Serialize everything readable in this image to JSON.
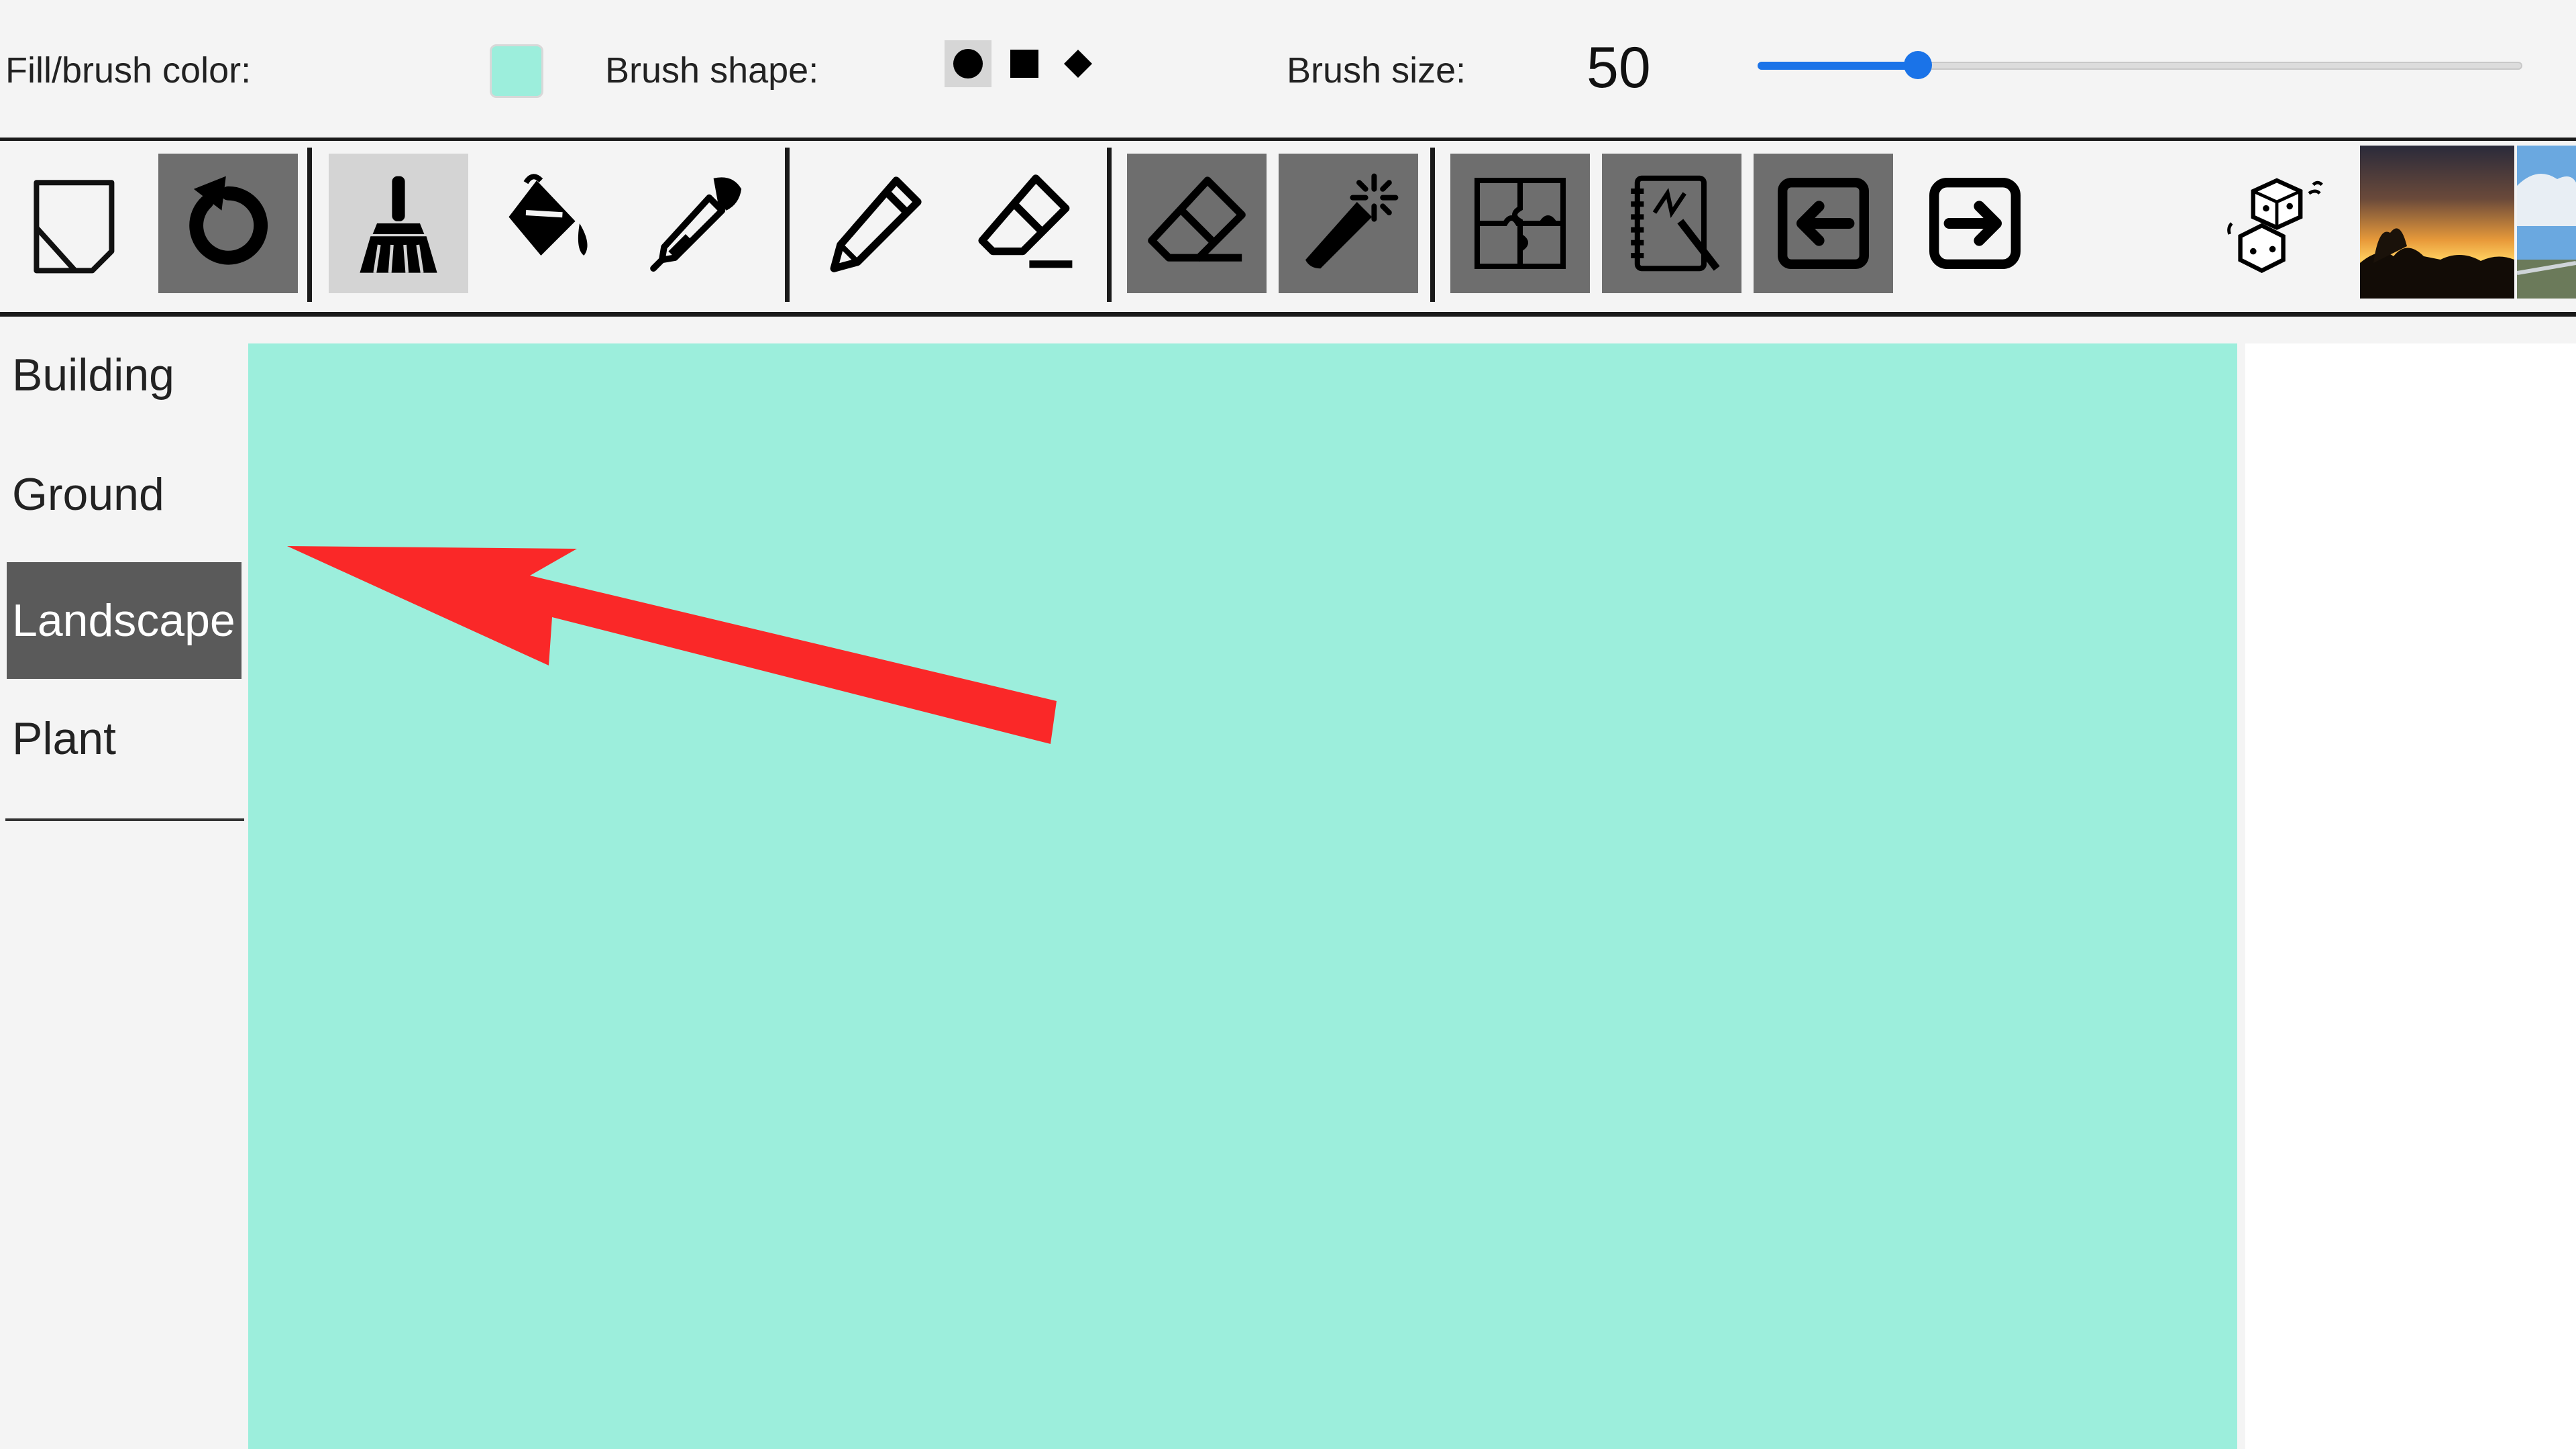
{
  "colors": {
    "brush": "#9ceedc",
    "canvas": "#9ceedc",
    "accent": "#1a73e8",
    "arrow": "#fa2828"
  },
  "options": {
    "color_label": "Fill/brush color:",
    "shape_label": "Brush shape:",
    "shapes": [
      "circle",
      "square",
      "diamond"
    ],
    "selected_shape": "circle",
    "size_label": "Brush size:",
    "size_value": "50",
    "size_fraction": 0.21
  },
  "toolbar": {
    "tools": [
      {
        "name": "new-canvas-icon",
        "state": "normal"
      },
      {
        "name": "reset-icon",
        "state": "dark"
      },
      {
        "name": "brush-icon",
        "state": "selected"
      },
      {
        "name": "fill-bucket-icon",
        "state": "normal"
      },
      {
        "name": "eyedropper-icon",
        "state": "normal"
      },
      {
        "name": "pencil-icon",
        "state": "normal"
      },
      {
        "name": "line-eraser-icon",
        "state": "normal"
      },
      {
        "name": "eraser-icon",
        "state": "dark"
      },
      {
        "name": "magic-wand-icon",
        "state": "dark"
      },
      {
        "name": "puzzle-icon",
        "state": "dark"
      },
      {
        "name": "sketchbook-icon",
        "state": "dark"
      },
      {
        "name": "undo-arrow-icon",
        "state": "dark"
      },
      {
        "name": "redo-arrow-icon",
        "state": "normal"
      },
      {
        "name": "dice-icon",
        "state": "normal"
      }
    ],
    "thumbnails": [
      "sunset-thumbnail",
      "sky-thumbnail"
    ]
  },
  "sidebar": {
    "categories": [
      {
        "label": "Building",
        "active": false
      },
      {
        "label": "Ground",
        "active": false
      },
      {
        "label": "Landscape",
        "active": true
      },
      {
        "label": "Plant",
        "active": false
      }
    ]
  }
}
